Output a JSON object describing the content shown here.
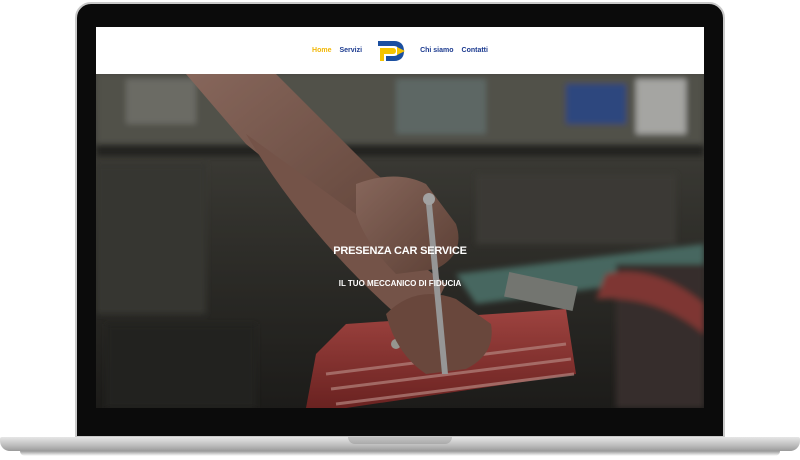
{
  "nav": {
    "items": [
      {
        "label": "Home",
        "active": true
      },
      {
        "label": "Servizi",
        "active": false
      },
      {
        "label": "Chi siamo",
        "active": false
      },
      {
        "label": "Contatti",
        "active": false
      }
    ],
    "logo_icon": "psc-logo-icon"
  },
  "hero": {
    "title": "PRESENZA CAR SERVICE",
    "subtitle": "IL TUO MECCANICO DI FIDUCIA"
  },
  "colors": {
    "nav_link": "#1b3a8f",
    "nav_active": "#f2b705",
    "logo_blue": "#1b4fa0",
    "logo_yellow": "#f5c400"
  }
}
